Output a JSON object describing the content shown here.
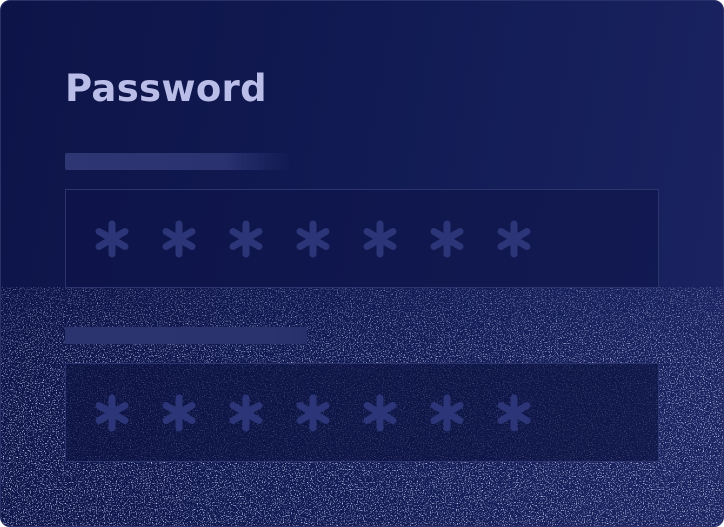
{
  "card": {
    "title": "Password"
  },
  "fields": [
    {
      "name": "password-field",
      "masked_chars": 7
    },
    {
      "name": "confirm-password-field",
      "masked_chars": 7
    }
  ],
  "icons": {
    "mask_char": "asterisk-icon"
  },
  "colors": {
    "background": "#111a52",
    "title": "#b9bde8",
    "field_border": "#2c3470",
    "mask": "#2c3577",
    "label_placeholder": "#2e3673"
  }
}
